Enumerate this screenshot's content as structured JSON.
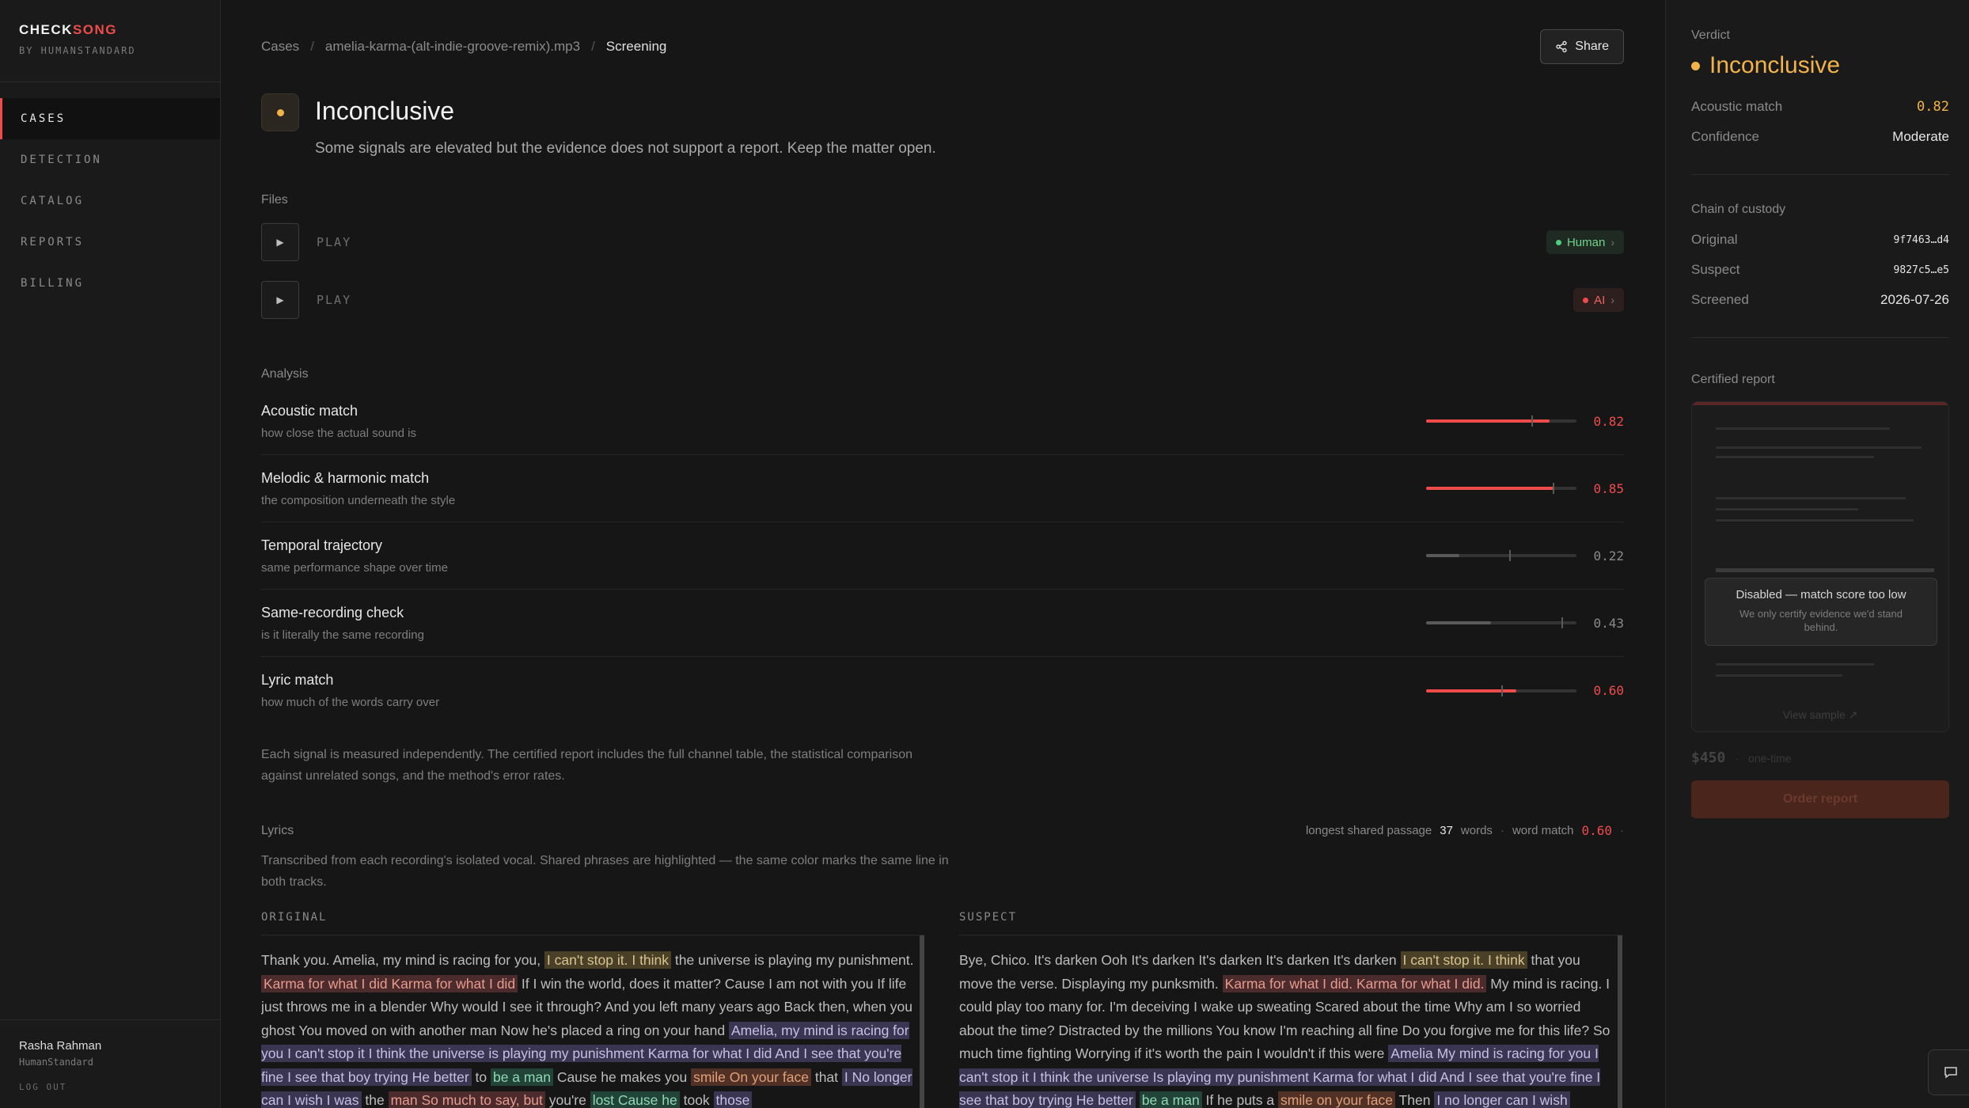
{
  "brand": {
    "name_a": "CHECK",
    "name_b": "SONG",
    "sub": "BY HUMANSTANDARD"
  },
  "nav": {
    "items": [
      {
        "label": "CASES"
      },
      {
        "label": "DETECTION"
      },
      {
        "label": "CATALOG"
      },
      {
        "label": "REPORTS"
      },
      {
        "label": "BILLING"
      }
    ]
  },
  "user": {
    "name": "Rasha Rahman",
    "org": "HumanStandard",
    "logout": "LOG OUT"
  },
  "breadcrumb": {
    "items": [
      "Cases",
      "amelia-karma-(alt-indie-groove-remix).mp3",
      "Screening"
    ],
    "sep": "/"
  },
  "share_label": "Share",
  "verdict": {
    "title": "Inconclusive",
    "description": "Some signals are elevated but the evidence does not support a report. Keep the matter open."
  },
  "files": {
    "label": "Files",
    "items": [
      {
        "play_label": "PLAY",
        "badge": "Human"
      },
      {
        "play_label": "PLAY",
        "badge": "AI"
      }
    ]
  },
  "analysis": {
    "label": "Analysis",
    "metrics": [
      {
        "name": "Acoustic match",
        "sub": "how close the actual sound is",
        "value": "0.82",
        "fill": 0.82,
        "mark": 0.7,
        "color": "#ef4b4b"
      },
      {
        "name": "Melodic & harmonic match",
        "sub": "the composition underneath the style",
        "value": "0.85",
        "fill": 0.85,
        "mark": 0.84,
        "color": "#ef4b4b"
      },
      {
        "name": "Temporal trajectory",
        "sub": "same performance shape over time",
        "value": "0.22",
        "fill": 0.22,
        "mark": 0.55,
        "color": "#5a5a5a"
      },
      {
        "name": "Same-recording check",
        "sub": "is it literally the same recording",
        "value": "0.43",
        "fill": 0.43,
        "mark": 0.9,
        "color": "#5a5a5a"
      },
      {
        "name": "Lyric match",
        "sub": "how much of the words carry over",
        "value": "0.60",
        "fill": 0.6,
        "mark": 0.5,
        "color": "#ef4b4b"
      }
    ],
    "note": "Each signal is measured independently. The certified report includes the full channel table, the statistical comparison against unrelated songs, and the method's error rates."
  },
  "lyrics": {
    "label": "Lyrics",
    "stat_prefix": "longest shared passage",
    "stat_words": "37",
    "stat_suffix": "words",
    "word_match_label": "word match",
    "word_match_value": "0.60",
    "description": "Transcribed from each recording's isolated vocal. Shared phrases are highlighted — the same color marks the same line in both tracks.",
    "original_label": "ORIGINAL",
    "suspect_label": "SUSPECT",
    "original": [
      {
        "t": "Thank you. Amelia, my mind is racing for you, "
      },
      {
        "t": "I can't stop it. I think",
        "h": "h1"
      },
      {
        "t": " the universe is playing my punishment. "
      },
      {
        "t": "Karma for what I did Karma for what I did",
        "h": "h2"
      },
      {
        "t": " If I win the world, does it matter? Cause I am not with you If life just throws me in a blender Why would I see it through? And you left many years ago Back then, when you ghost You moved on with another man Now he's placed a ring on your hand "
      },
      {
        "t": "Amelia, my mind is racing for you I can't stop it I think the universe is playing my punishment Karma for what I did And I see that you're fine I see that boy trying He better",
        "h": "h3"
      },
      {
        "t": " to "
      },
      {
        "t": "be a man",
        "h": "h4"
      },
      {
        "t": " Cause he makes you "
      },
      {
        "t": "smile On your face",
        "h": "h5"
      },
      {
        "t": " that "
      },
      {
        "t": "I No longer can I wish I was",
        "h": "h3"
      },
      {
        "t": " the "
      },
      {
        "t": "man So much to say, but",
        "h": "h2"
      },
      {
        "t": " you're "
      },
      {
        "t": "lost Cause he",
        "h": "h4"
      },
      {
        "t": " took "
      },
      {
        "t": "those",
        "h": "h3"
      }
    ],
    "suspect": [
      {
        "t": "Bye, Chico. It's darken Ooh It's darken It's darken It's darken It's darken "
      },
      {
        "t": "I can't stop it. I think",
        "h": "h1"
      },
      {
        "t": " that you move the verse. Displaying my punksmith. "
      },
      {
        "t": "Karma for what I did. Karma for what I did.",
        "h": "h2"
      },
      {
        "t": " My mind is racing. I could play too many for. I'm deceiving I wake up sweating Scared about the time Why am I so worried about the time? Distracted by the millions You know I'm reaching all fine Do you forgive me for this life? So much time fighting Worrying if it's worth the pain I wouldn't if this were "
      },
      {
        "t": "Amelia My mind is racing for you I can't stop it I think the universe Is playing my punishment Karma for what I did And I see that you're fine I see that boy trying He better",
        "h": "h3"
      },
      {
        "t": " "
      },
      {
        "t": "be a man",
        "h": "h4"
      },
      {
        "t": " If he puts a "
      },
      {
        "t": "smile on your face",
        "h": "h5"
      },
      {
        "t": " Then "
      },
      {
        "t": "I no longer can I wish",
        "h": "h3"
      }
    ]
  },
  "right_panel": {
    "verdict_label": "Verdict",
    "verdict": "Inconclusive",
    "acoustic_label": "Acoustic match",
    "acoustic_value": "0.82",
    "confidence_label": "Confidence",
    "confidence_value": "Moderate",
    "custody_label": "Chain of custody",
    "original_label": "Original",
    "original_hash": "9f7463…d4",
    "suspect_label": "Suspect",
    "suspect_hash": "9827c5…e5",
    "screened_label": "Screened",
    "screened_value": "2026-07-26",
    "certified_label": "Certified report",
    "disabled_title": "Disabled — match score too low",
    "disabled_sub": "We only certify evidence we'd stand behind.",
    "view_sample": "View sample ↗",
    "price": "$450",
    "price_sub": "one-time",
    "order_label": "Order report"
  },
  "colors": {
    "accent": "#ef4b4b",
    "amber": "#f2b34a",
    "human": "#4ed07a"
  }
}
